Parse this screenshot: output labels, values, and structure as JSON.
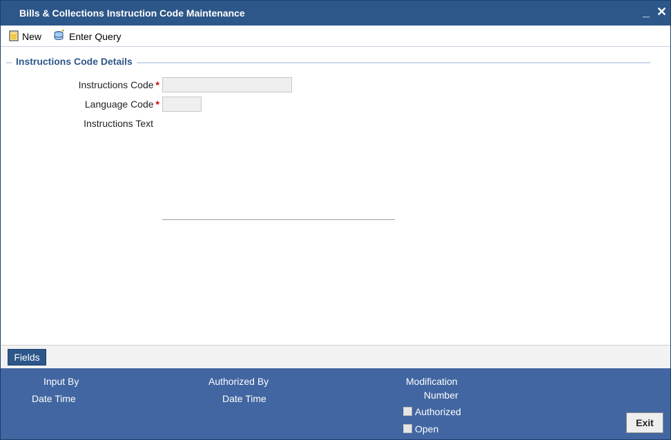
{
  "window": {
    "title": "Bills & Collections Instruction Code Maintenance",
    "minimize_glyph": "_",
    "close_glyph": "✕"
  },
  "toolbar": {
    "new_label": "New",
    "new_icon": "new-document-icon",
    "enter_query_label": "Enter Query",
    "enter_query_icon": "enter-query-icon"
  },
  "section": {
    "title": "Instructions Code Details"
  },
  "form": {
    "instructions_code_label": "Instructions Code",
    "instructions_code_value": "",
    "language_code_label": "Language Code",
    "language_code_value": "",
    "instructions_text_label": "Instructions Text",
    "instructions_text_value": "",
    "required_marker": "*"
  },
  "tabs": {
    "fields_label": "Fields"
  },
  "footer": {
    "input_by_label": "Input By",
    "date_time_label_1": "Date Time",
    "authorized_by_label": "Authorized By",
    "date_time_label_2": "Date Time",
    "modification_label": "Modification",
    "number_label": "Number",
    "authorized_checkbox_label": "Authorized",
    "open_checkbox_label": "Open",
    "exit_label": "Exit"
  },
  "colors": {
    "titlebar": "#2d5689",
    "footer": "#4166a1",
    "required": "#d40000"
  }
}
